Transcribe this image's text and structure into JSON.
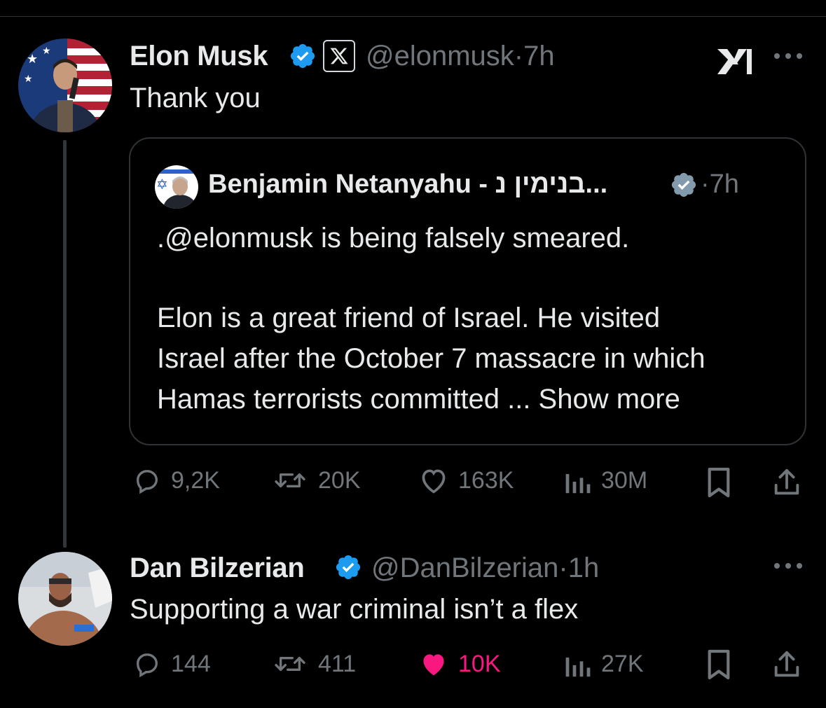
{
  "tweet": {
    "author_name": "Elon Musk",
    "handle": "@elonmusk",
    "time": "7h",
    "separator": "·",
    "text": "Thank you",
    "quote": {
      "author_name": "Benjamin Netanyahu - בנימין נ...",
      "time": "7h",
      "line1": ".@elonmusk is being falsely smeared.",
      "line2": "Elon is a great friend of Israel.  He visited",
      "line3": "Israel after the October 7 massacre in which",
      "line4": "Hamas terrorists committed ... Show more"
    },
    "actions": {
      "replies": "9,2K",
      "reposts": "20K",
      "likes": "163K",
      "views": "30M"
    }
  },
  "reply": {
    "author_name": "Dan Bilzerian",
    "handle": "@DanBilzerian",
    "time": "1h",
    "separator": "·",
    "text": "Supporting a war criminal isn’t a flex",
    "actions": {
      "replies": "144",
      "reposts": "411",
      "likes": "10K",
      "views": "27K"
    }
  },
  "colors": {
    "background": "#000000",
    "text_primary": "#e7e9ea",
    "text_secondary": "#71767b",
    "verified_blue": "#1d9bf0",
    "verified_gray": "#829aab",
    "like_pink": "#f91880",
    "border": "#2f3336"
  },
  "icons": {
    "verified": "verified-badge-icon",
    "x_logo": "x-logo-icon",
    "xai_logo": "xai-logo-icon",
    "more": "more-icon",
    "reply": "reply-icon",
    "repost": "repost-icon",
    "like": "heart-icon",
    "views": "views-icon",
    "bookmark": "bookmark-icon",
    "share": "share-icon"
  }
}
